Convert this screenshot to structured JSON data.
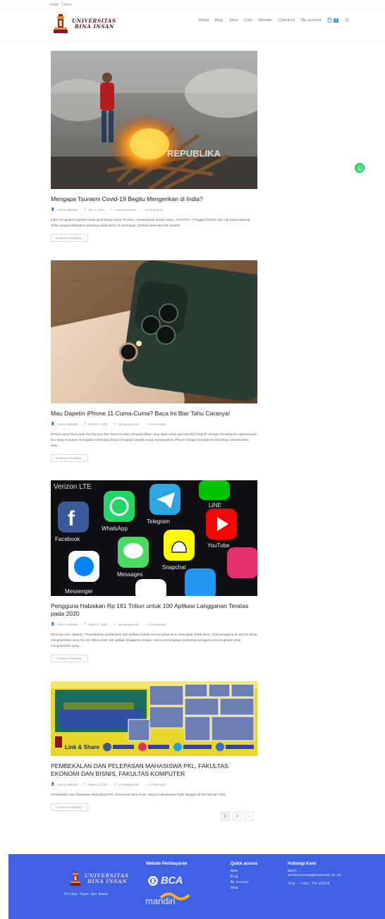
{
  "topbar": {
    "items": [
      "Cetak",
      "Check"
    ]
  },
  "logo": {
    "line1": "UNIVERSITAS",
    "line2": "BINA INSAN"
  },
  "nav": {
    "items": [
      "Detail",
      "Blog",
      "Shop",
      "Cart",
      "Website",
      "Checkout",
      "My account"
    ],
    "cart_count": "0"
  },
  "posts": [
    {
      "title": "Mengapa Tsunami Covid-19 Begitu Mengerikan di India?",
      "author": "Admin Website",
      "date": "Mei 1, 2021",
      "category": "Uncategorized",
      "comments": "0 Comments",
      "excerpt": "India mengalami lonjakan besar gelombang kedua Tsunami, menewaskan ribuan orang. JAKARTA – Penggiat lebaran dan cap kota Kaliurang Delta, warga Kabupaten utamanya pada kasus di meninggal. Delama beberapa hari terakhir,",
      "more": "Continue Reading",
      "watermark": "REPUBLIKA"
    },
    {
      "title": "Mau Dapetin iPhone 11 Cuma-Cuma? Baca Ini Biar Tahu Caranya!",
      "author": "Admin Website",
      "date": "Maret 6, 2021",
      "category": "Uncategorized",
      "comments": "0 Comments",
      "excerpt": "Desain yang fokus pada fitur kamera dan mesin ini akan menjadi pilihan yang tepat untuk para pecinta fotografi, dengan kemampuan optimal pada fitur yang mumpuni merupakan beberapa alasan mengapa banyak orang menginginkan iPhone sebagai smartphone favoritnya. Berdasarkan data...",
      "more": "Continue Reading"
    },
    {
      "title": "Pengguna Habiskan Rp 181 Triliun untuk 100 Aplikasi Langganan Teratas pada 2020",
      "author": "Admin Website",
      "date": "Maret 6, 2021",
      "category": "Uncategorized",
      "comments": "0 Comments",
      "excerpt": "Ekonomi.com, Jakarta - Pertumbuhan pendapatan dari aplikasi mobile secara global terus meningkat. Pada tahun 2020 pengguna di seluruh dunia menghabiskan uang Rp 181 triliun untuk 100 aplikasi langganan teratas. Hal ini menunjukkan kebiasaan pengguna secara global untuk mengeluarkan uang...",
      "more": "Continue Reading",
      "apps": [
        "Facebook",
        "WhatsApp",
        "Telegram",
        "LINE",
        "Snapchat",
        "YouTube",
        "Messenger",
        "Messages",
        "Verizon LTE"
      ]
    },
    {
      "title": "PEMBEKALAN DAN PELEPASAN MAHASISWA PKL, FAKULTAS EKONOMI DAN BISNIS, FAKULTAS KOMPUTER",
      "author": "Admin Website",
      "date": "Maret 3, 2021",
      "category": "Uncategorized",
      "comments": "0 Comments",
      "excerpt": "Pembekalan dan Pelepasan Mahasiswa PKL Universitas Bina Insan Yang di Laksanakan Pada Tanggal 19-20 Februari 2021",
      "more": "Continue Reading",
      "banner_text": "Link & Share"
    }
  ],
  "pagination": {
    "pages": [
      "1",
      "2"
    ],
    "next": "›"
  },
  "footer": {
    "tagline": "Pilihan Tepat dan Hemat",
    "payment_title": "Metode Pembayaran",
    "bca": "BCA",
    "mandiri": "mandiri",
    "quick_title": "Quick access",
    "quick_links": [
      "Home",
      "Blog",
      "My Account",
      "Shop"
    ],
    "contact_title": "Hubungi Kami",
    "email_label": "Email :",
    "email": "univbinainsan@binainsan.ac.id",
    "phone": "Telp : (+62) 733-452218"
  },
  "colors": {
    "footer_bg": "#3f61e3",
    "accent": "#3b8fd6",
    "whatsapp": "#25d366"
  }
}
